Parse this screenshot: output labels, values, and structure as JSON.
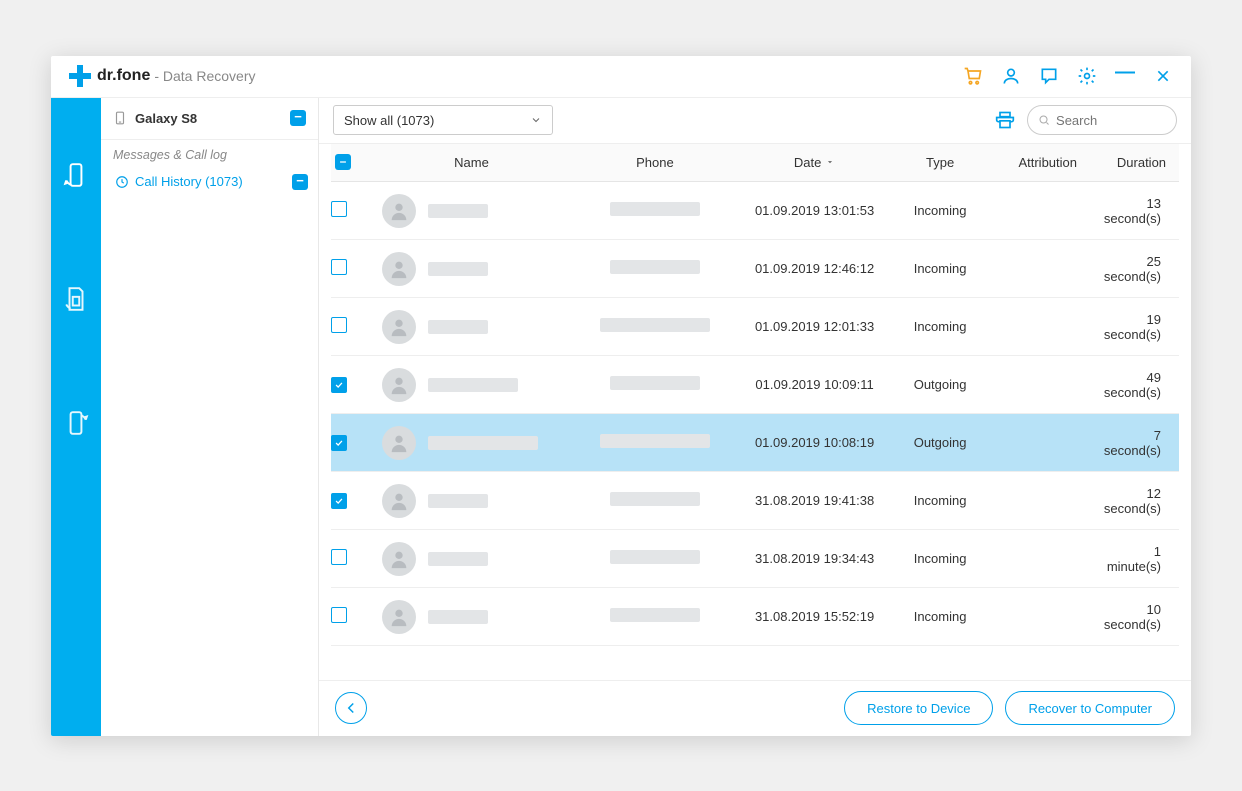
{
  "app": {
    "name": "dr.fone",
    "section": "- Data Recovery"
  },
  "sidebar": {
    "device": "Galaxy S8",
    "section_label": "Messages & Call log",
    "call_history_label": "Call History (1073)"
  },
  "toolbar": {
    "filter_label": "Show all (1073)",
    "search_placeholder": "Search"
  },
  "columns": {
    "name": "Name",
    "phone": "Phone",
    "date": "Date",
    "type": "Type",
    "attribution": "Attribution",
    "duration": "Duration"
  },
  "rows": [
    {
      "checked": false,
      "selected": false,
      "date": "01.09.2019 13:01:53",
      "type": "Incoming",
      "attribution": "",
      "duration": "13 second(s)"
    },
    {
      "checked": false,
      "selected": false,
      "date": "01.09.2019 12:46:12",
      "type": "Incoming",
      "attribution": "",
      "duration": "25 second(s)"
    },
    {
      "checked": false,
      "selected": false,
      "date": "01.09.2019 12:01:33",
      "type": "Incoming",
      "attribution": "",
      "duration": "19 second(s)"
    },
    {
      "checked": true,
      "selected": false,
      "date": "01.09.2019 10:09:11",
      "type": "Outgoing",
      "attribution": "",
      "duration": "49 second(s)"
    },
    {
      "checked": true,
      "selected": true,
      "date": "01.09.2019 10:08:19",
      "type": "Outgoing",
      "attribution": "",
      "duration": "7 second(s)"
    },
    {
      "checked": true,
      "selected": false,
      "date": "31.08.2019 19:41:38",
      "type": "Incoming",
      "attribution": "",
      "duration": "12 second(s)"
    },
    {
      "checked": false,
      "selected": false,
      "date": "31.08.2019 19:34:43",
      "type": "Incoming",
      "attribution": "",
      "duration": "1 minute(s)"
    },
    {
      "checked": false,
      "selected": false,
      "date": "31.08.2019 15:52:19",
      "type": "Incoming",
      "attribution": "",
      "duration": "10 second(s)"
    }
  ],
  "footer": {
    "restore": "Restore to Device",
    "recover": "Recover to Computer"
  }
}
